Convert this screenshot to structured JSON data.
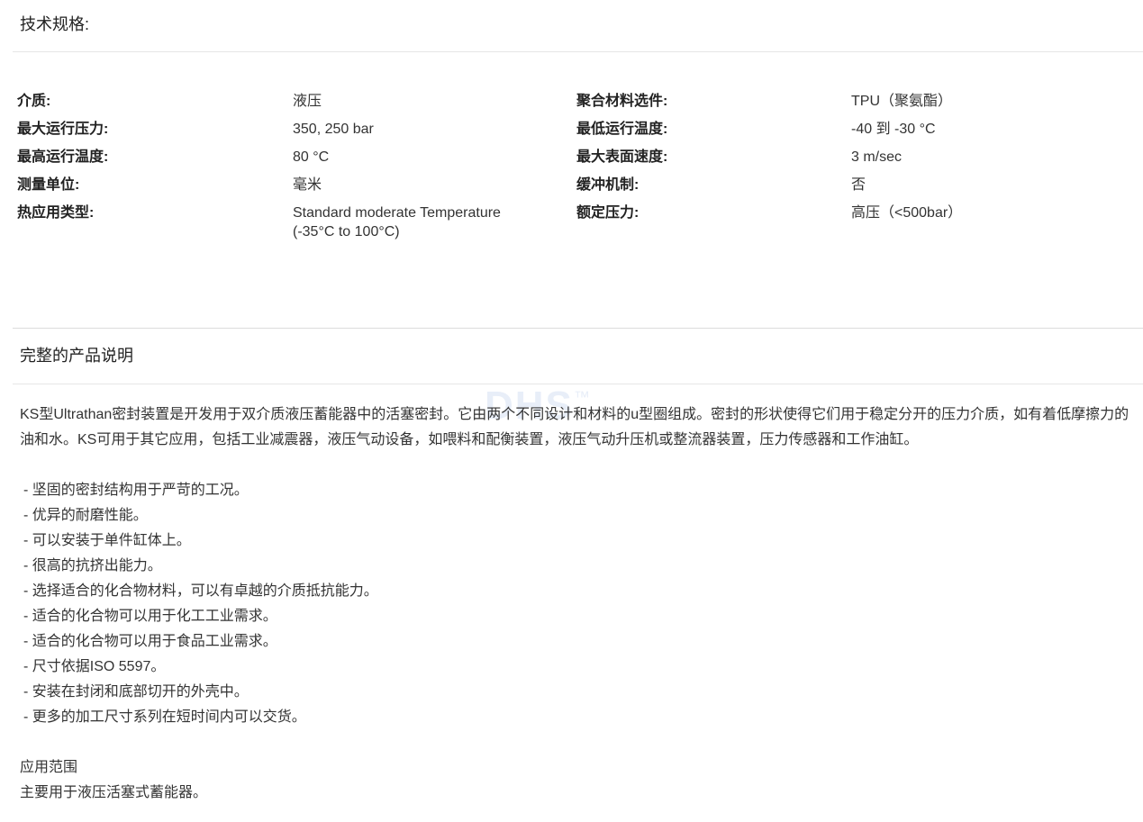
{
  "specs_section": {
    "title": "技术规格:",
    "rows": [
      {
        "label_left": "介质:",
        "value_left": "液压",
        "label_right": "聚合材料选件:",
        "value_right": "TPU（聚氨酯）"
      },
      {
        "label_left": "最大运行压力:",
        "value_left": "350, 250 bar",
        "label_right": "最低运行温度:",
        "value_right": "-40 到 -30 °C"
      },
      {
        "label_left": "最高运行温度:",
        "value_left": "80 °C",
        "label_right": "最大表面速度:",
        "value_right": "3 m/sec"
      },
      {
        "label_left": "测量单位:",
        "value_left": "毫米",
        "label_right": "缓冲机制:",
        "value_right": "否"
      },
      {
        "label_left": "热应用类型:",
        "value_left": "Standard moderate Temperature\n(-35°C to 100°C)",
        "label_right": "额定压力:",
        "value_right": "高压（<500bar）"
      }
    ]
  },
  "description_section": {
    "title": "完整的产品说明",
    "watermark": "DHS",
    "watermark_tm": "™",
    "intro": "KS型Ultrathan密封装置是开发用于双介质液压蓄能器中的活塞密封。它由两个不同设计和材料的u型圈组成。密封的形状使得它们用于稳定分开的压力介质，如有着低摩擦力的油和水。KS可用于其它应用，包括工业减震器，液压气动设备，如喂料和配衡装置，液压气动升压机或整流器装置，压力传感器和工作油缸。",
    "features": [
      "- 坚固的密封结构用于严苛的工况。",
      "- 优异的耐磨性能。",
      "- 可以安装于单件缸体上。",
      "- 很高的抗挤出能力。",
      "- 选择适合的化合物材料，可以有卓越的介质抵抗能力。",
      "- 适合的化合物可以用于化工工业需求。",
      "- 适合的化合物可以用于食品工业需求。",
      "- 尺寸依据ISO 5597。",
      "- 安装在封闭和底部切开的外壳中。",
      "- 更多的加工尺寸系列在短时间内可以交货。"
    ],
    "application_heading": "应用范围",
    "application_text": "主要用于液压活塞式蓄能器。"
  }
}
